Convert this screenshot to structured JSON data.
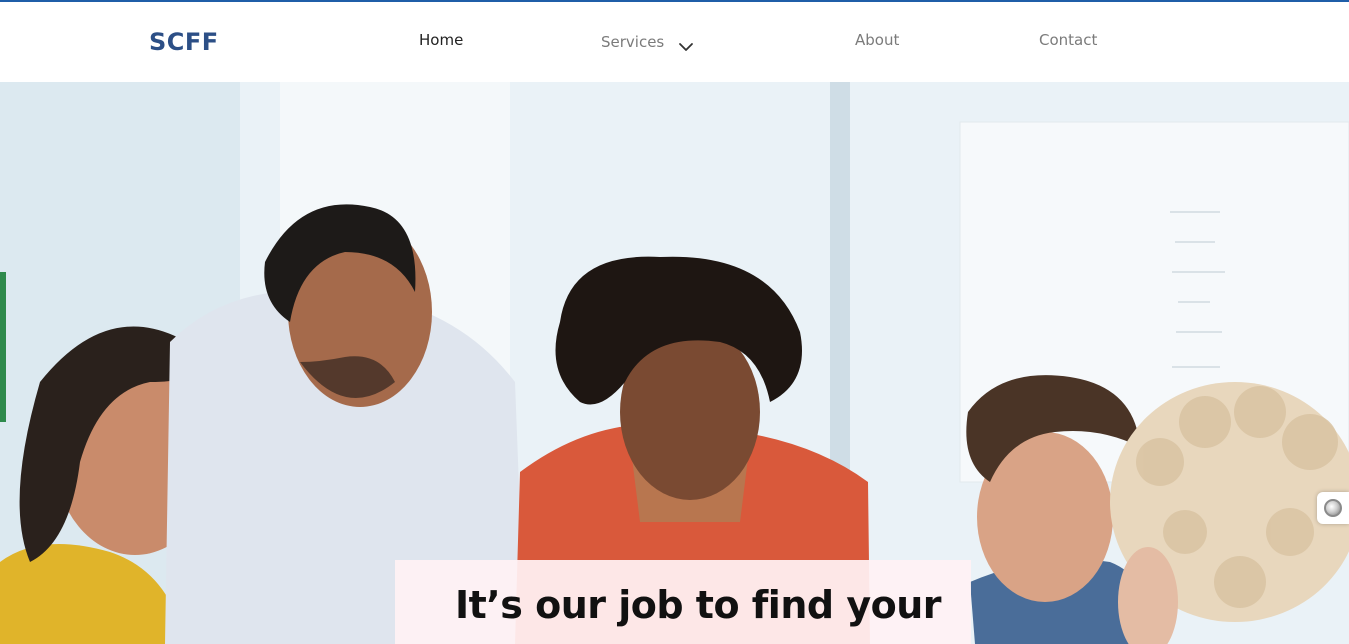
{
  "brand": {
    "logo_text": "SCFF",
    "logo_color": "#2c4f86",
    "top_line_color": "#1f5ea8"
  },
  "nav": {
    "home_label": "Home",
    "services_label": "Services",
    "services_icon": "chevron-down-icon",
    "about_label": "About",
    "contact_label": "Contact"
  },
  "hero": {
    "title": "It’s our job to find your",
    "image_description": "team-photo",
    "card_color": "#fff2f4"
  },
  "widget": {
    "icon": "circle-icon"
  }
}
